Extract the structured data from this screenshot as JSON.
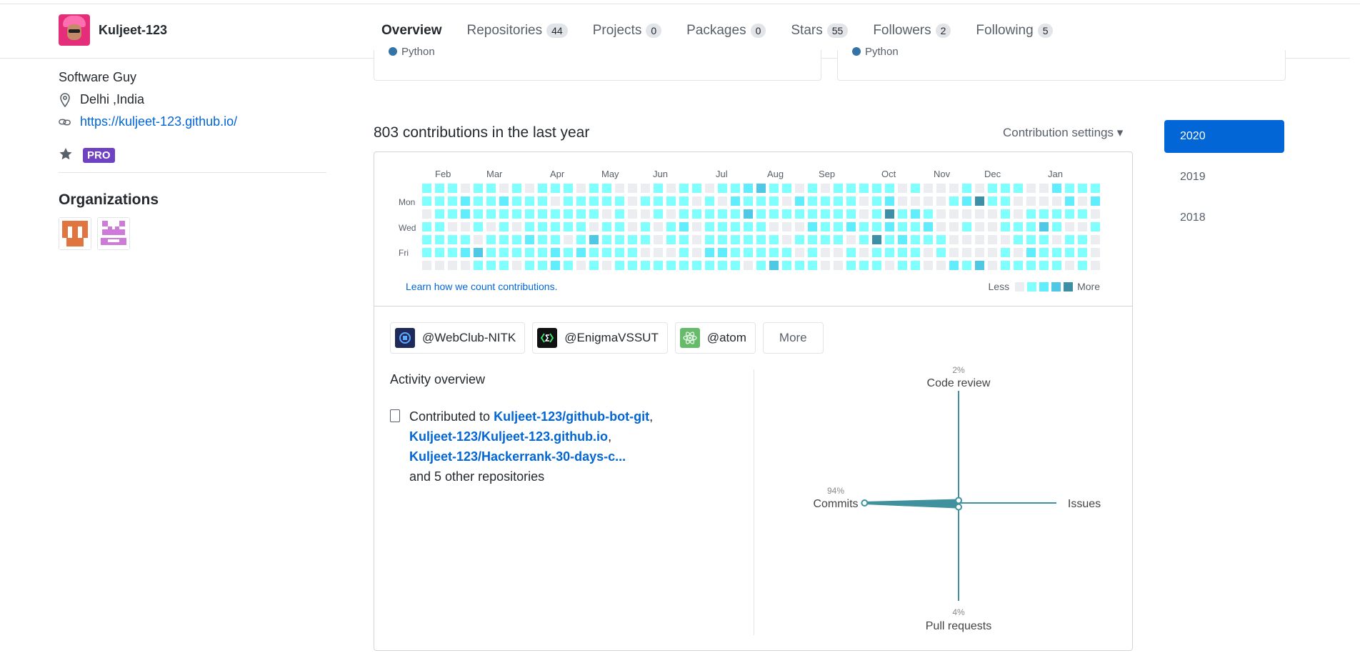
{
  "header": {
    "username": "Kuljeet-123",
    "tabs": [
      {
        "label": "Overview",
        "count": ""
      },
      {
        "label": "Repositories",
        "count": "44"
      },
      {
        "label": "Projects",
        "count": "0"
      },
      {
        "label": "Packages",
        "count": "0"
      },
      {
        "label": "Stars",
        "count": "55"
      },
      {
        "label": "Followers",
        "count": "2"
      },
      {
        "label": "Following",
        "count": "5"
      }
    ]
  },
  "sidebar": {
    "bio": "Software Guy",
    "location": "Delhi ,India",
    "website": "https://kuljeet-123.github.io/",
    "pro_label": "PRO",
    "organizations_title": "Organizations"
  },
  "pinned": {
    "lang": "Python"
  },
  "contributions": {
    "title": "803 contributions in the last year",
    "settings_label": "Contribution settings ▾",
    "months": [
      "Feb",
      "Mar",
      "Apr",
      "May",
      "Jun",
      "Jul",
      "Aug",
      "Sep",
      "Oct",
      "Nov",
      "Dec",
      "Jan"
    ],
    "day_labels": [
      "Mon",
      "Wed",
      "Fri"
    ],
    "learn_link": "Learn how we count contributions.",
    "legend_less": "Less",
    "legend_more": "More",
    "colors": [
      "#ebedf0",
      "#80ffff",
      "#60eeff",
      "#4fc8e6",
      "#3d8fa6"
    ]
  },
  "years": [
    "2020",
    "2019",
    "2018"
  ],
  "activity": {
    "org_buttons": [
      "@WebClub-NITK",
      "@EnigmaVSSUT",
      "@atom"
    ],
    "more_label": "More",
    "title": "Activity overview",
    "contributed_prefix": "Contributed to",
    "repos": [
      "Kuljeet-123/github-bot-git",
      "Kuljeet-123/Kuljeet-123.github.io",
      "Kuljeet-123/Hackerrank-30-days-c..."
    ],
    "others": "and 5 other repositories",
    "radar": {
      "code_review_pct": "2%",
      "code_review_label": "Code review",
      "commits_pct": "94%",
      "commits_label": "Commits",
      "issues_label": "Issues",
      "pull_pct": "4%",
      "pull_label": "Pull requests",
      "values": {
        "commits": 94,
        "code_review": 2,
        "pull_requests": 4,
        "issues": 0
      },
      "color": "#40919e"
    }
  }
}
